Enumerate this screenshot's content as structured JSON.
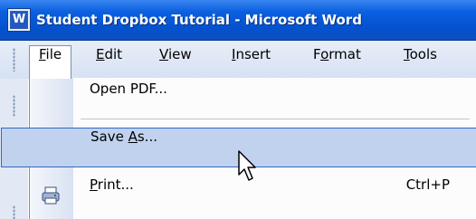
{
  "window": {
    "title": "Student Dropbox Tutorial - Microsoft Word",
    "app_icon_letter": "W"
  },
  "menubar": {
    "items": [
      {
        "label_pre": "",
        "label_key": "F",
        "label_post": "ile",
        "active": true
      },
      {
        "label_pre": "",
        "label_key": "E",
        "label_post": "dit"
      },
      {
        "label_pre": "",
        "label_key": "V",
        "label_post": "iew"
      },
      {
        "label_pre": "",
        "label_key": "I",
        "label_post": "nsert"
      },
      {
        "label_pre": "F",
        "label_key": "o",
        "label_post": "rmat"
      },
      {
        "label_pre": "",
        "label_key": "T",
        "label_post": "ools"
      }
    ]
  },
  "file_menu": {
    "open_pdf": "Open PDF...",
    "save_as_pre": "Save ",
    "save_as_key": "A",
    "save_as_post": "s...",
    "print_key": "P",
    "print_post": "rint...",
    "print_shortcut": "Ctrl+P",
    "print_icon": "printer-icon"
  },
  "cursor": "arrow-cursor-icon"
}
